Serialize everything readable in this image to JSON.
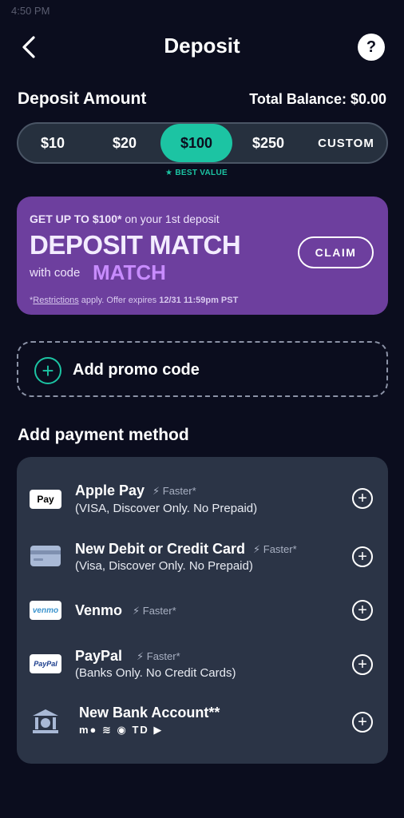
{
  "status_bar": {
    "time": "4:50 PM"
  },
  "header": {
    "title": "Deposit",
    "back_icon": "chevron-left-icon",
    "help_icon": "help-bubble-icon",
    "help_glyph": "?"
  },
  "deposit": {
    "label": "Deposit Amount",
    "balance": "Total Balance: $0.00"
  },
  "amounts": {
    "options": [
      "$10",
      "$20",
      "$100",
      "$250",
      "CUSTOM"
    ],
    "selected": "$100",
    "best_value": "★ BEST VALUE"
  },
  "promo": {
    "top_bold": "GET UP TO $100*",
    "top_light": " on your 1st deposit",
    "title": "DEPOSIT MATCH",
    "with_code": "with code",
    "code": "MATCH",
    "fine_prefix": "*",
    "fine_link": "Restrictions",
    "fine_mid": " apply. Offer expires ",
    "fine_date": "12/31 11:59pm PST",
    "claim": "CLAIM",
    "accent": "#6d3f9e"
  },
  "promo_code": {
    "label": "Add promo code",
    "plus": "+",
    "accent": "#1cc4a3"
  },
  "payment": {
    "label": "Add payment method",
    "methods": [
      {
        "name": "Apple Pay",
        "faster": "Faster*",
        "sub": "(VISA, Discover Only. No Prepaid)",
        "icon": "apple-pay-icon",
        "icon_text": "Pay"
      },
      {
        "name": "New Debit or Credit Card",
        "faster": "Faster*",
        "sub": "(Visa, Discover Only. No Prepaid)",
        "icon": "credit-card-icon"
      },
      {
        "name": "Venmo",
        "faster": "Faster*",
        "sub": "",
        "icon": "venmo-icon",
        "icon_text": "venmo"
      },
      {
        "name": "PayPal",
        "faster": "Faster*",
        "sub": "(Banks Only. No Credit Cards)",
        "icon": "paypal-icon",
        "icon_text": "PayPal"
      },
      {
        "name": "New Bank Account**",
        "faster": "",
        "sub": "",
        "icon": "bank-icon",
        "banks": "m● ≋ ◉ TD ▶"
      }
    ],
    "add_glyph": "+",
    "faster_glyph": "⚡"
  }
}
